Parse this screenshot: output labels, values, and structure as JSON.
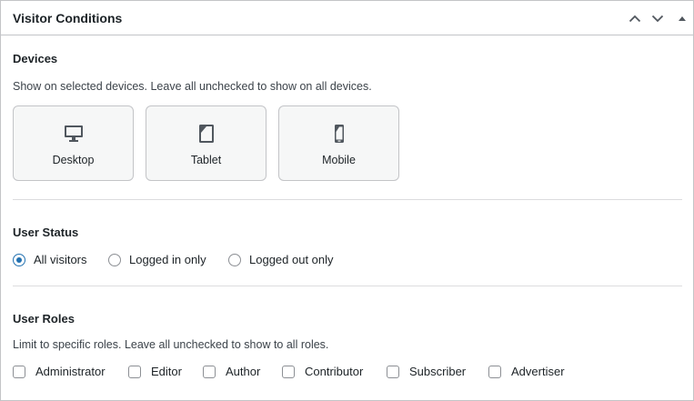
{
  "panel": {
    "title": "Visitor Conditions",
    "header_icons": [
      "chevron-up-icon",
      "chevron-down-icon",
      "caret-up-icon"
    ]
  },
  "devices": {
    "title": "Devices",
    "description": "Show on selected devices. Leave all unchecked to show on all devices.",
    "options": [
      {
        "label": "Desktop",
        "icon": "desktop-icon",
        "selected": false
      },
      {
        "label": "Tablet",
        "icon": "tablet-icon",
        "selected": false
      },
      {
        "label": "Mobile",
        "icon": "mobile-icon",
        "selected": false
      }
    ]
  },
  "user_status": {
    "title": "User Status",
    "options": [
      {
        "label": "All visitors",
        "checked": true
      },
      {
        "label": "Logged in only",
        "checked": false
      },
      {
        "label": "Logged out only",
        "checked": false
      }
    ]
  },
  "user_roles": {
    "title": "User Roles",
    "description": "Limit to specific roles. Leave all unchecked to show to all roles.",
    "options": [
      {
        "label": "Administrator",
        "checked": false
      },
      {
        "label": "Editor",
        "checked": false
      },
      {
        "label": "Author",
        "checked": false
      },
      {
        "label": "Contributor",
        "checked": false
      },
      {
        "label": "Subscriber",
        "checked": false
      },
      {
        "label": "Advertiser",
        "checked": false
      }
    ]
  },
  "colors": {
    "accent": "#2271b1",
    "border": "#c3c4c7",
    "text": "#1d2327",
    "icon": "#50575e"
  }
}
